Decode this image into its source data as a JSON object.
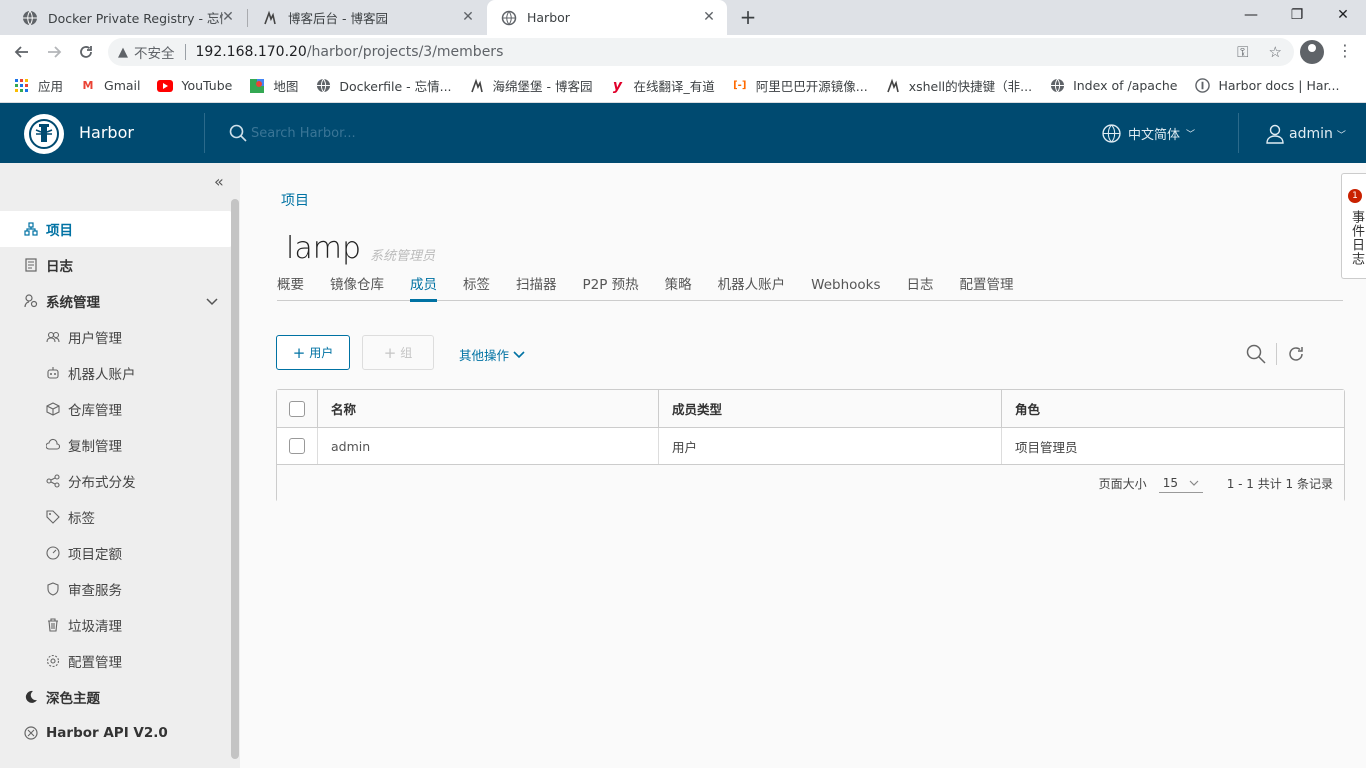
{
  "browser": {
    "tabs": [
      {
        "title": "Docker Private Registry - 忘情",
        "icon": "globe-icon"
      },
      {
        "title": "博客后台 - 博客园",
        "icon": "cnblogs-icon"
      },
      {
        "title": "Harbor",
        "icon": "globe-icon",
        "active": true
      }
    ],
    "address": {
      "security_label": "不安全",
      "host": "192.168.170.20",
      "path": "/harbor/projects/3/members"
    },
    "bookmarks": [
      {
        "label": "应用",
        "icon": "apps-icon"
      },
      {
        "label": "Gmail",
        "icon": "gmail-icon"
      },
      {
        "label": "YouTube",
        "icon": "youtube-icon"
      },
      {
        "label": "地图",
        "icon": "maps-icon"
      },
      {
        "label": "Dockerfile - 忘情...",
        "icon": "globe-icon"
      },
      {
        "label": "海绵堡堡 - 博客园",
        "icon": "cnblogs-icon"
      },
      {
        "label": "在线翻译_有道",
        "icon": "youdao-icon"
      },
      {
        "label": "阿里巴巴开源镜像...",
        "icon": "aliyun-icon"
      },
      {
        "label": "xshell的快捷键（非...",
        "icon": "cnblogs-icon"
      },
      {
        "label": "Index of /apache",
        "icon": "globe-icon"
      },
      {
        "label": "Harbor docs | Har...",
        "icon": "harbor-docs-icon"
      }
    ]
  },
  "header": {
    "brand": "Harbor",
    "search_placeholder": "Search Harbor...",
    "language": "中文简体",
    "user": "admin"
  },
  "sidebar": {
    "items": [
      {
        "label": "项目",
        "icon": "projects-icon",
        "active": true,
        "level": "top"
      },
      {
        "label": "日志",
        "icon": "logs-icon",
        "level": "top"
      },
      {
        "label": "系统管理",
        "icon": "admin-icon",
        "level": "top",
        "expanded": true
      },
      {
        "label": "用户管理",
        "icon": "users-icon",
        "level": "sub"
      },
      {
        "label": "机器人账户",
        "icon": "robot-icon",
        "level": "sub"
      },
      {
        "label": "仓库管理",
        "icon": "registry-icon",
        "level": "sub"
      },
      {
        "label": "复制管理",
        "icon": "replication-icon",
        "level": "sub"
      },
      {
        "label": "分布式分发",
        "icon": "share-icon",
        "level": "sub"
      },
      {
        "label": "标签",
        "icon": "tag-icon",
        "level": "sub"
      },
      {
        "label": "项目定额",
        "icon": "quota-icon",
        "level": "sub"
      },
      {
        "label": "审查服务",
        "icon": "shield-icon",
        "level": "sub"
      },
      {
        "label": "垃圾清理",
        "icon": "trash-icon",
        "level": "sub"
      },
      {
        "label": "配置管理",
        "icon": "gear-icon",
        "level": "sub"
      },
      {
        "label": "深色主题",
        "icon": "moon-icon",
        "level": "top"
      },
      {
        "label": "Harbor API V2.0",
        "icon": "api-icon",
        "level": "top"
      }
    ]
  },
  "main": {
    "breadcrumb": "项目",
    "project_name": "lamp",
    "project_role": "系统管理员",
    "tabs": [
      "概要",
      "镜像仓库",
      "成员",
      "标签",
      "扫描器",
      "P2P 预热",
      "策略",
      "机器人账户",
      "Webhooks",
      "日志",
      "配置管理"
    ],
    "active_tab": "成员",
    "buttons": {
      "add_user": "用户",
      "add_group": "组",
      "more_ops": "其他操作"
    },
    "table": {
      "columns": [
        "名称",
        "成员类型",
        "角色"
      ],
      "rows": [
        [
          "admin",
          "用户",
          "项目管理员"
        ]
      ]
    },
    "footer": {
      "page_size_label": "页面大小",
      "page_size": "15",
      "summary": "1 - 1 共计 1 条记录"
    }
  },
  "event_log": {
    "label": "事件日志",
    "badge": "1"
  },
  "colors": {
    "header_bg": "#004a70",
    "accent": "#0072a3",
    "sidebar_bg": "#eeeeee",
    "badge": "#c92100"
  }
}
